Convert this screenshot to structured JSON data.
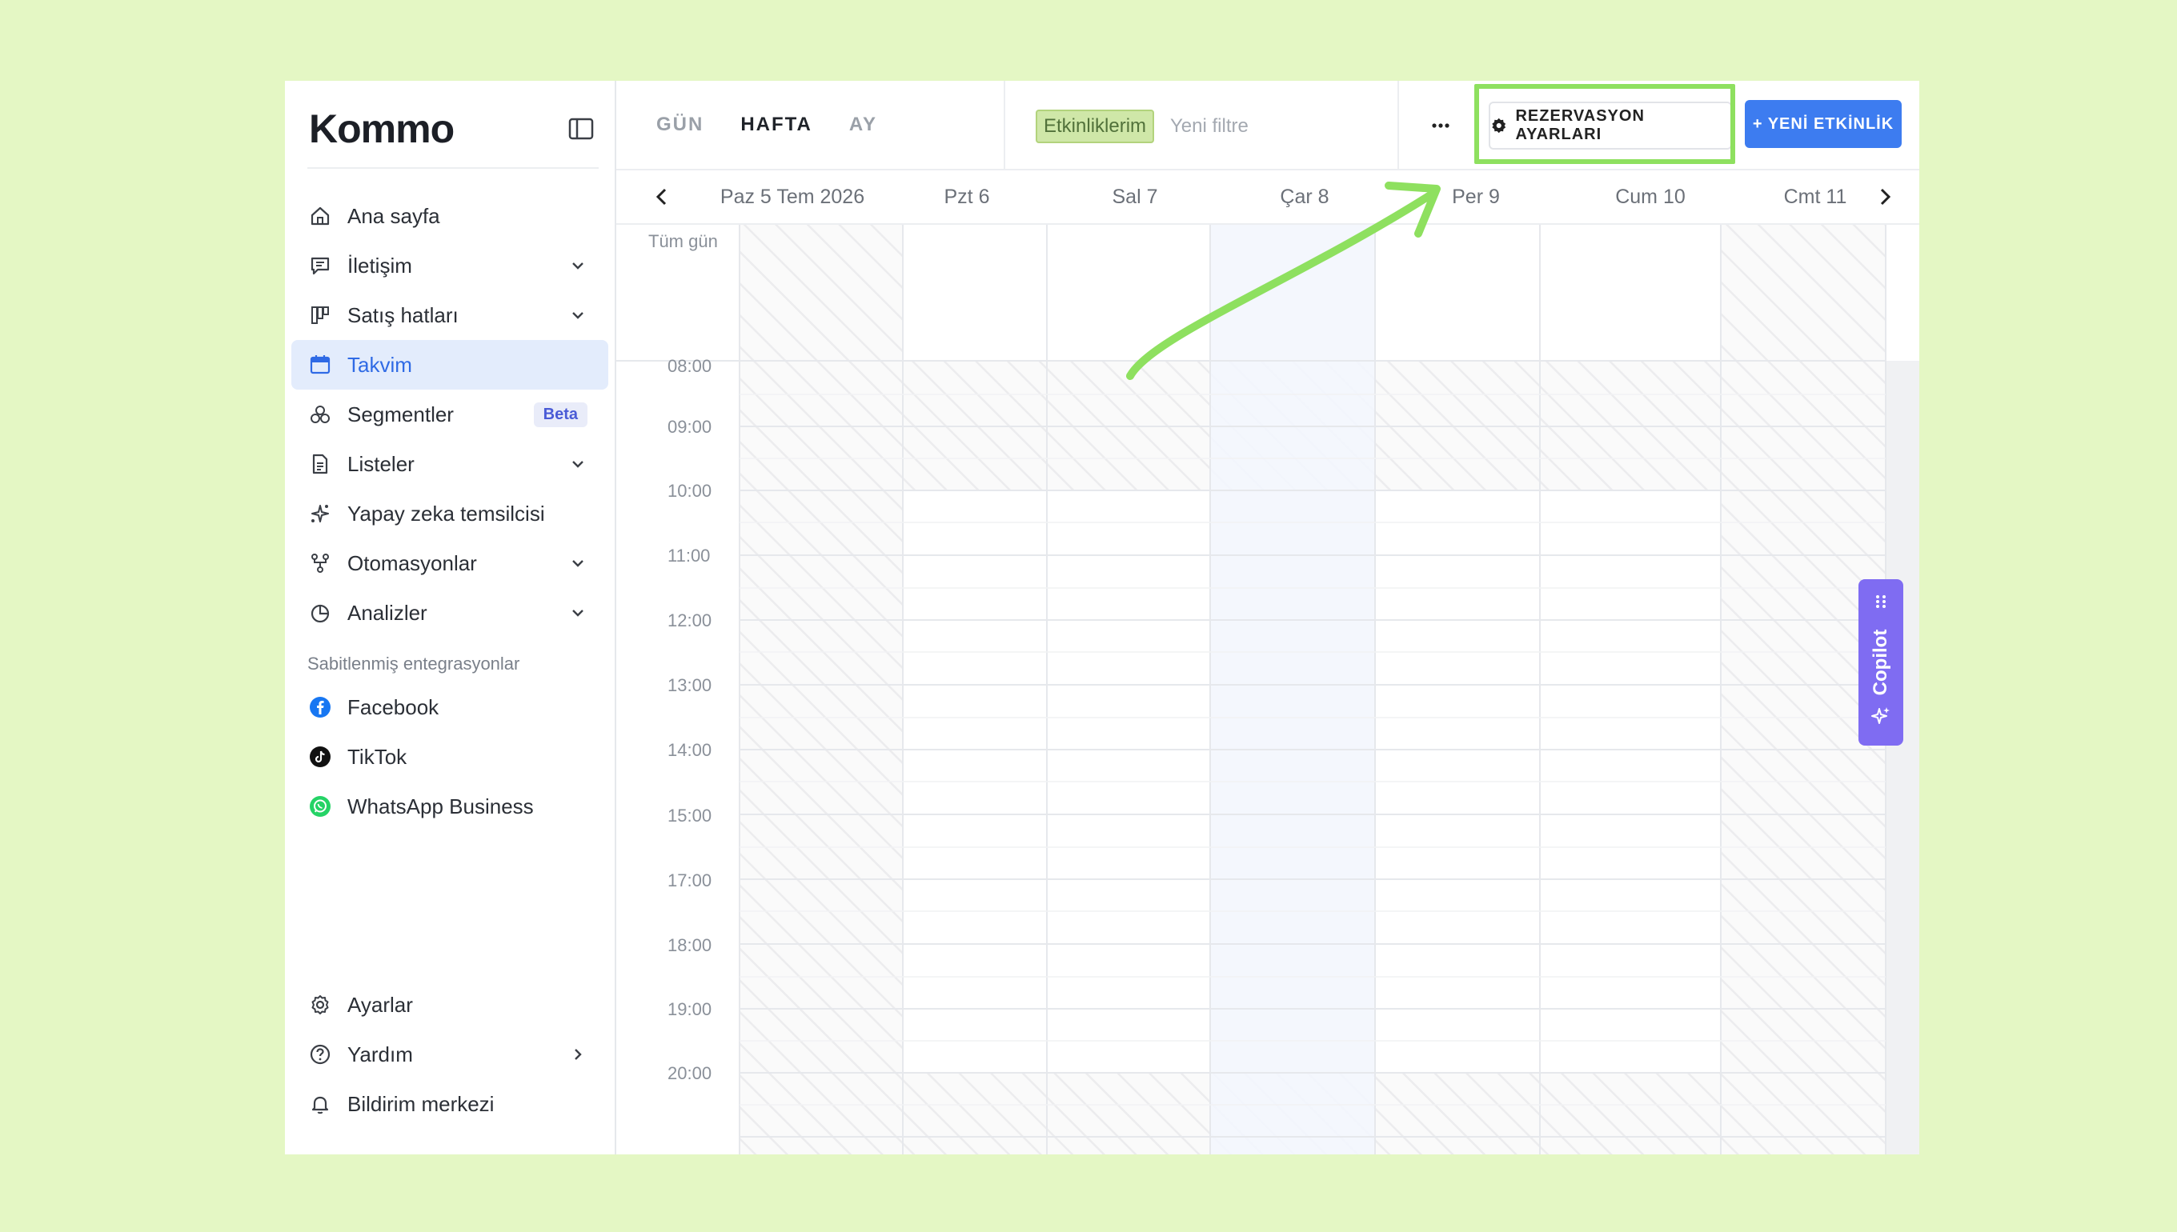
{
  "app": {
    "logo": "Kommo"
  },
  "sidebar": {
    "items": [
      {
        "label": "Ana sayfa",
        "icon": "home-icon",
        "chevron": false
      },
      {
        "label": "İletişim",
        "icon": "chat-icon",
        "chevron": true
      },
      {
        "label": "Satış hatları",
        "icon": "pipeline-icon",
        "chevron": true
      },
      {
        "label": "Takvim",
        "icon": "calendar-icon",
        "chevron": false,
        "active": true
      },
      {
        "label": "Segmentler",
        "icon": "segments-icon",
        "badge": "Beta"
      },
      {
        "label": "Listeler",
        "icon": "list-icon",
        "chevron": true
      },
      {
        "label": "Yapay zeka temsilcisi",
        "icon": "sparkle-icon",
        "chevron": false
      },
      {
        "label": "Otomasyonlar",
        "icon": "automation-icon",
        "chevron": true
      },
      {
        "label": "Analizler",
        "icon": "analytics-icon",
        "chevron": true
      }
    ],
    "pinned_title": "Sabitlenmiş entegrasyonlar",
    "pinned": [
      {
        "label": "Facebook",
        "icon": "facebook-icon",
        "color": "#1877f2"
      },
      {
        "label": "TikTok",
        "icon": "tiktok-icon",
        "color": "#111111"
      },
      {
        "label": "WhatsApp Business",
        "icon": "whatsapp-icon",
        "color": "#25d366"
      }
    ],
    "bottom": [
      {
        "label": "Ayarlar",
        "icon": "settings-icon"
      },
      {
        "label": "Yardım",
        "icon": "help-icon",
        "chevron": true
      },
      {
        "label": "Bildirim merkezi",
        "icon": "bell-icon"
      }
    ]
  },
  "toolbar": {
    "views": [
      "GÜN",
      "HAFTA",
      "AY"
    ],
    "active_view": "HAFTA",
    "filter_chip": "Etkinliklerim",
    "filter_placeholder": "Yeni filtre",
    "more": "···",
    "reservation_label": "REZERVASYON AYARLARI",
    "new_event_label": "+ YENİ ETKİNLİK"
  },
  "calendar": {
    "days": [
      "Paz 5 Tem 2026",
      "Pzt 6",
      "Sal 7",
      "Çar 8",
      "Per 9",
      "Cum 10",
      "Cmt 11"
    ],
    "allday_label": "Tüm gün",
    "hours": [
      "08:00",
      "09:00",
      "10:00",
      "11:00",
      "12:00",
      "13:00",
      "14:00",
      "15:00",
      "17:00",
      "18:00",
      "19:00",
      "20:00"
    ]
  },
  "copilot": {
    "label": "Copilot"
  },
  "colors": {
    "accent": "#3d7cf0",
    "highlight": "#8ee05f",
    "active_bg": "#e3ecfc",
    "copilot": "#7f6cf2"
  }
}
